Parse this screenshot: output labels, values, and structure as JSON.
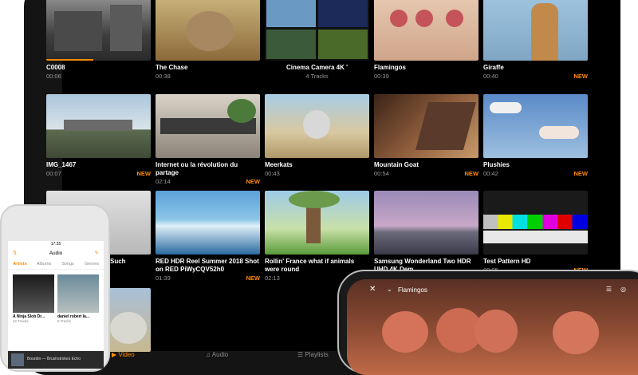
{
  "tablet": {
    "tiles": [
      {
        "title": "C0008",
        "sub": "00:06",
        "new": "",
        "center": false,
        "progress": 0.45
      },
      {
        "title": "The Chase",
        "sub": "00:38",
        "new": "",
        "center": false
      },
      {
        "title": "Cinema Camera 4K '",
        "sub": "4 Tracks",
        "new": "",
        "center": true
      },
      {
        "title": "Flamingos",
        "sub": "00:39",
        "new": "",
        "center": false
      },
      {
        "title": "Giraffe",
        "sub": "00:40",
        "new": "NEW",
        "center": false
      },
      {
        "title": "IMG_1467",
        "sub": "00:07",
        "new": "NEW",
        "center": false
      },
      {
        "title": "Internet ou la révolution du partage",
        "sub": "02:14",
        "new": "NEW",
        "center": false
      },
      {
        "title": "Meerkats",
        "sub": "00:43",
        "new": "",
        "center": false
      },
      {
        "title": "Mountain Goat",
        "sub": "00:54",
        "new": "NEW",
        "center": false
      },
      {
        "title": "Plushies",
        "sub": "00:42",
        "new": "NEW",
        "center": false
      },
      {
        "title": "Such",
        "sub": "",
        "new": "",
        "center": false
      },
      {
        "title": "RED HDR Reel Summer 2018 Shot on RED PiWyCQV52h0",
        "sub": "01:39",
        "new": "NEW",
        "center": false
      },
      {
        "title": "Rollin' France what if animals were round",
        "sub": "02:13",
        "new": "",
        "center": false
      },
      {
        "title": "Samsung Wonderland Two HDR UHD 4K Dem",
        "sub": "",
        "new": "",
        "center": false
      },
      {
        "title": "Test Pattern HD",
        "sub": "00:05",
        "new": "NEW",
        "center": false
      }
    ],
    "tabbar": {
      "video": "Video",
      "audio": "Audio",
      "playlists": "Playlists"
    }
  },
  "phone": {
    "time": "17:35",
    "nav_title": "Audio",
    "tabs": [
      "Artists",
      "Albums",
      "Songs",
      "Genres"
    ],
    "items": [
      {
        "name": "A Ninja Slob Dr...",
        "count": "22 Tracks"
      },
      {
        "name": "daniel robert la...",
        "count": "6 Tracks"
      }
    ],
    "mini_player": "Bourdin — Brushstrokes Echo"
  },
  "iphone": {
    "title": "Flamingos"
  },
  "colors": {
    "accent": "#ff8a00",
    "background": "#000000"
  }
}
